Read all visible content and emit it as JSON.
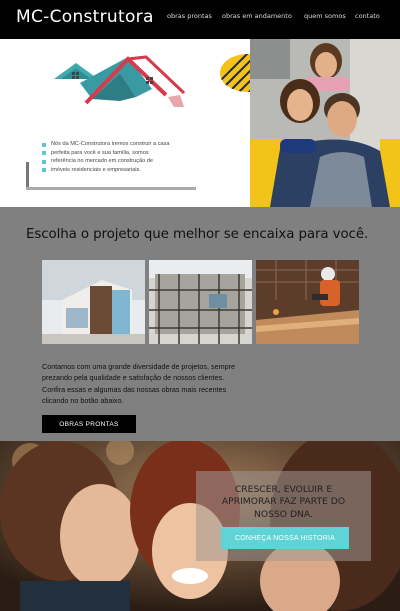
{
  "nav": {
    "brand": "MC-Construtora",
    "links": [
      "obras prontas",
      "obras em andamento",
      "quem somos",
      "contato"
    ]
  },
  "hero": {
    "lines": [
      "Nós da MC-Construtora iremos construir a casa",
      "perfeita para você e sua família, somos",
      "referência no mercado em construção de",
      "imóveis  residenciais e empresariais."
    ]
  },
  "projects": {
    "title": "Escolha o projeto que melhor se encaixa para você.",
    "description": [
      "Contamos com uma grande diversidade de projetos, sempre",
      "prezando pela qualidade e satisfação de nossos clientes.",
      "Confira essas e algumas das nossas obras mais recentes",
      "clicando no botão abaixo."
    ],
    "button_label": "OBRAS PRONTAS"
  },
  "dna": {
    "lines": [
      "CRESCER, EVOLUIR E",
      "APRIMORAR FAZ PARTE DO",
      "NOSSO DNA."
    ],
    "button_label": "CONHEÇA NOSSA HISTORIA"
  },
  "colors": {
    "accent_cyan": "#5fd3d6",
    "roof_teal": "#3fa9b0",
    "roof_red": "#d73a4a",
    "accent_yellow": "#f4c21b"
  },
  "icons": [
    "house-logo-icon",
    "bullet-icon"
  ]
}
